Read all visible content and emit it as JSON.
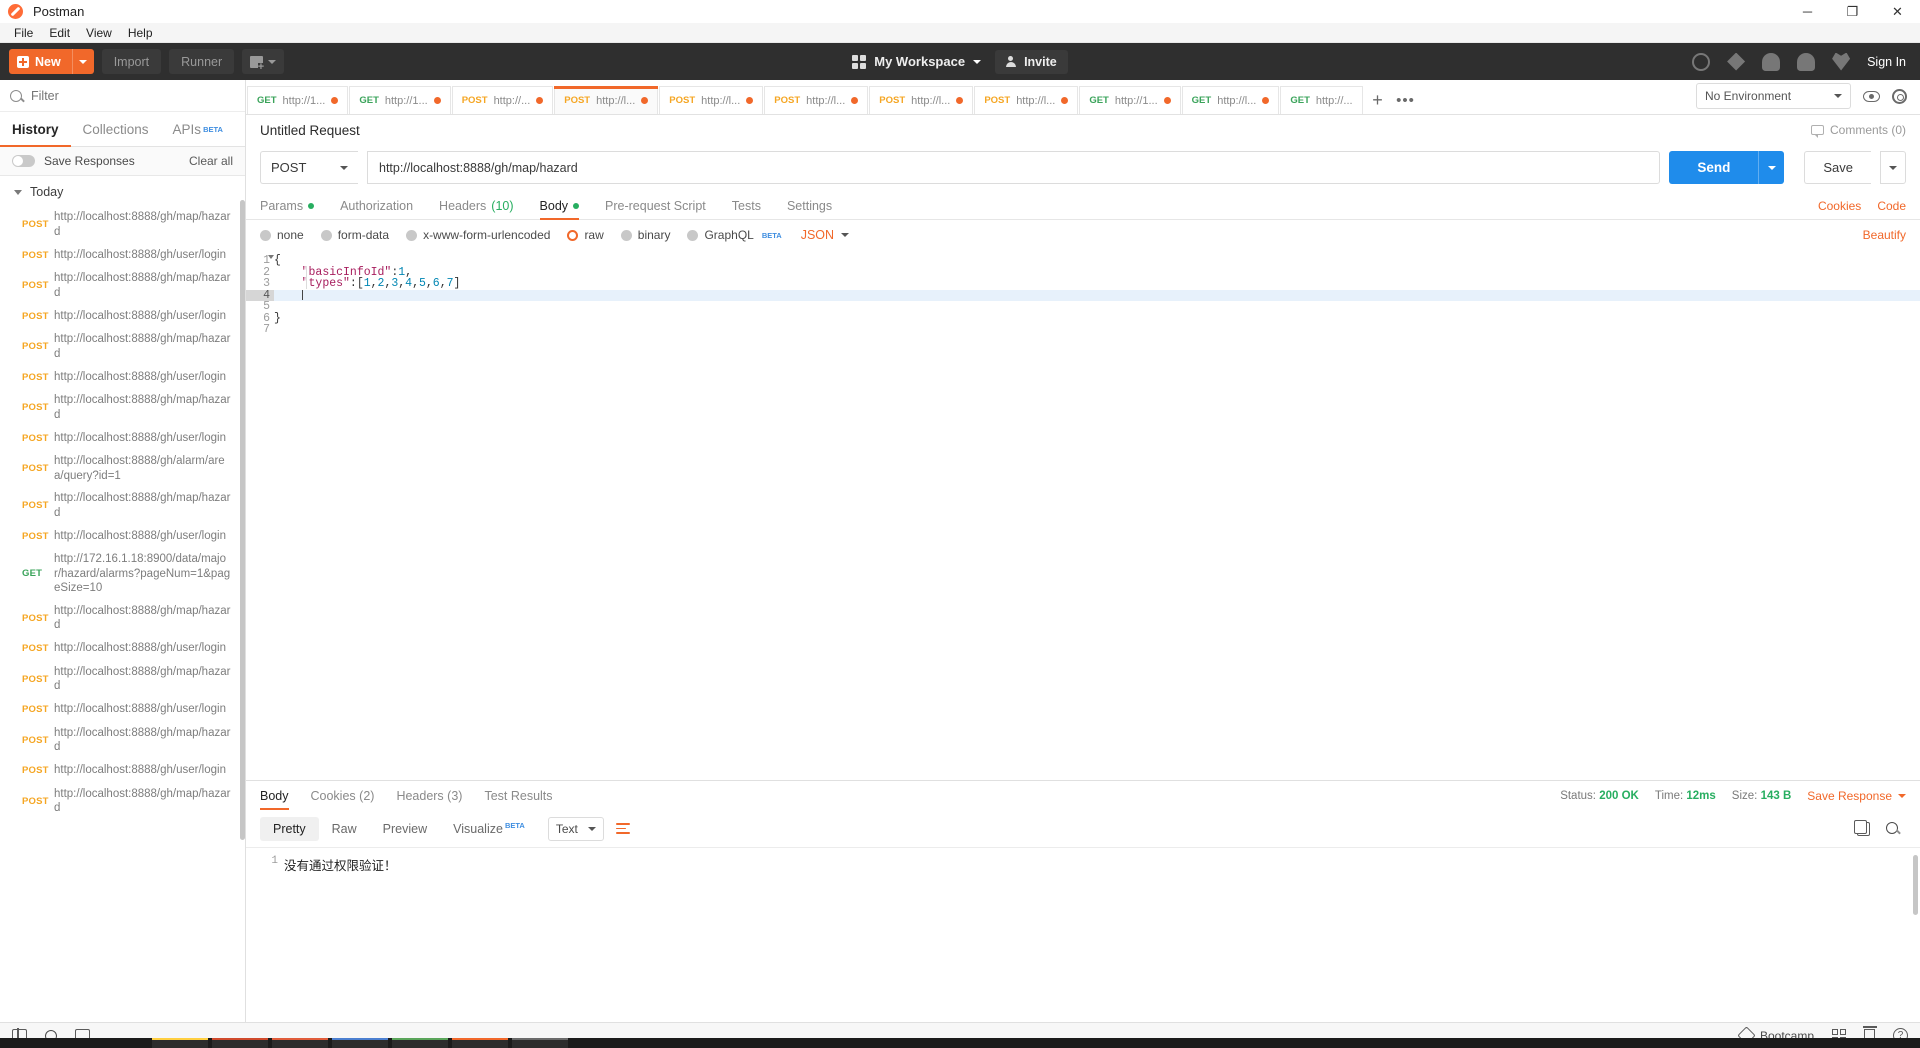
{
  "window": {
    "title": "Postman",
    "minimize": "─",
    "maximize": "❐",
    "close": "✕"
  },
  "menubar": [
    "File",
    "Edit",
    "View",
    "Help"
  ],
  "toolbar": {
    "new_label": "New",
    "import_label": "Import",
    "runner_label": "Runner",
    "workspace_label": "My Workspace",
    "invite_label": "Invite",
    "sign_in_label": "Sign In"
  },
  "sidebar": {
    "filter_placeholder": "Filter",
    "tabs": [
      {
        "label": "History",
        "active": true,
        "beta": ""
      },
      {
        "label": "Collections",
        "active": false,
        "beta": ""
      },
      {
        "label": "APIs",
        "active": false,
        "beta": "BETA"
      }
    ],
    "save_responses_label": "Save Responses",
    "clear_all_label": "Clear all",
    "group_label": "Today",
    "history": [
      {
        "method": "POST",
        "url": "http://localhost:8888/gh/map/hazard"
      },
      {
        "method": "POST",
        "url": "http://localhost:8888/gh/user/login"
      },
      {
        "method": "POST",
        "url": "http://localhost:8888/gh/map/hazard"
      },
      {
        "method": "POST",
        "url": "http://localhost:8888/gh/user/login"
      },
      {
        "method": "POST",
        "url": "http://localhost:8888/gh/map/hazard"
      },
      {
        "method": "POST",
        "url": "http://localhost:8888/gh/user/login"
      },
      {
        "method": "POST",
        "url": "http://localhost:8888/gh/map/hazard"
      },
      {
        "method": "POST",
        "url": "http://localhost:8888/gh/user/login"
      },
      {
        "method": "POST",
        "url": "http://localhost:8888/gh/alarm/area/query?id=1"
      },
      {
        "method": "POST",
        "url": "http://localhost:8888/gh/map/hazard"
      },
      {
        "method": "POST",
        "url": "http://localhost:8888/gh/user/login"
      },
      {
        "method": "GET",
        "url": "http://172.16.1.18:8900/data/major/hazard/alarms?pageNum=1&pageSize=10"
      },
      {
        "method": "POST",
        "url": "http://localhost:8888/gh/map/hazard"
      },
      {
        "method": "POST",
        "url": "http://localhost:8888/gh/user/login"
      },
      {
        "method": "POST",
        "url": "http://localhost:8888/gh/map/hazard"
      },
      {
        "method": "POST",
        "url": "http://localhost:8888/gh/user/login"
      },
      {
        "method": "POST",
        "url": "http://localhost:8888/gh/map/hazard"
      },
      {
        "method": "POST",
        "url": "http://localhost:8888/gh/user/login"
      },
      {
        "method": "POST",
        "url": "http://localhost:8888/gh/map/hazard"
      }
    ]
  },
  "request_tabs": [
    {
      "method": "GET",
      "url": "http://1...",
      "active": false,
      "dirty": true
    },
    {
      "method": "GET",
      "url": "http://1...",
      "active": false,
      "dirty": true
    },
    {
      "method": "POST",
      "url": "http://...",
      "active": false,
      "dirty": true
    },
    {
      "method": "POST",
      "url": "http://l...",
      "active": true,
      "dirty": true
    },
    {
      "method": "POST",
      "url": "http://l...",
      "active": false,
      "dirty": true
    },
    {
      "method": "POST",
      "url": "http://l...",
      "active": false,
      "dirty": true
    },
    {
      "method": "POST",
      "url": "http://l...",
      "active": false,
      "dirty": true
    },
    {
      "method": "POST",
      "url": "http://l...",
      "active": false,
      "dirty": true
    },
    {
      "method": "GET",
      "url": "http://1...",
      "active": false,
      "dirty": true
    },
    {
      "method": "GET",
      "url": "http://l...",
      "active": false,
      "dirty": true
    },
    {
      "method": "GET",
      "url": "http://...",
      "active": false,
      "dirty": false
    }
  ],
  "tabstrip": {
    "add_label": "+",
    "more_label": "•••"
  },
  "environment": {
    "selected": "No Environment"
  },
  "request": {
    "title": "Untitled Request",
    "comments_label": "Comments (0)",
    "method": "POST",
    "url": "http://localhost:8888/gh/map/hazard",
    "send_label": "Send",
    "save_label": "Save",
    "tabs": [
      {
        "label": "Params",
        "dot": true,
        "count": "",
        "active": false
      },
      {
        "label": "Authorization",
        "dot": false,
        "count": "",
        "active": false
      },
      {
        "label": "Headers",
        "dot": false,
        "count": "(10)",
        "active": false
      },
      {
        "label": "Body",
        "dot": true,
        "count": "",
        "active": true
      },
      {
        "label": "Pre-request Script",
        "dot": false,
        "count": "",
        "active": false
      },
      {
        "label": "Tests",
        "dot": false,
        "count": "",
        "active": false
      },
      {
        "label": "Settings",
        "dot": false,
        "count": "",
        "active": false
      }
    ],
    "cookies_link": "Cookies",
    "code_link": "Code",
    "body_types": [
      {
        "label": "none",
        "selected": false
      },
      {
        "label": "form-data",
        "selected": false
      },
      {
        "label": "x-www-form-urlencoded",
        "selected": false
      },
      {
        "label": "raw",
        "selected": true
      },
      {
        "label": "binary",
        "selected": false
      },
      {
        "label": "GraphQL",
        "selected": false,
        "beta": "BETA"
      }
    ],
    "raw_format": "JSON",
    "beautify_label": "Beautify",
    "editor": {
      "line_numbers": [
        "1",
        "2",
        "3",
        "4",
        "5",
        "6",
        "7"
      ],
      "current_line": 4,
      "lines": [
        "{",
        "    \"basicInfoId\":1,",
        "    \"types\":[1,2,3,4,5,6,7]",
        "",
        "",
        "}",
        ""
      ],
      "body_json": {
        "basicInfoId": 1,
        "types": [
          1,
          2,
          3,
          4,
          5,
          6,
          7
        ]
      }
    }
  },
  "response": {
    "tabs": [
      {
        "label": "Body",
        "count": "",
        "active": true
      },
      {
        "label": "Cookies",
        "count": "(2)",
        "active": false
      },
      {
        "label": "Headers",
        "count": "(3)",
        "active": false
      },
      {
        "label": "Test Results",
        "count": "",
        "active": false
      }
    ],
    "status_label": "Status:",
    "status_value": "200 OK",
    "time_label": "Time:",
    "time_value": "12ms",
    "size_label": "Size:",
    "size_value": "143 B",
    "save_response_label": "Save Response",
    "format_tabs": [
      {
        "label": "Pretty",
        "active": true
      },
      {
        "label": "Raw",
        "active": false
      },
      {
        "label": "Preview",
        "active": false
      },
      {
        "label": "Visualize",
        "active": false,
        "beta": "BETA"
      }
    ],
    "body_format": "Text",
    "line_number": "1",
    "body_text": "没有通过权限验证！"
  },
  "statusbar": {
    "bootcamp_label": "Bootcamp"
  }
}
